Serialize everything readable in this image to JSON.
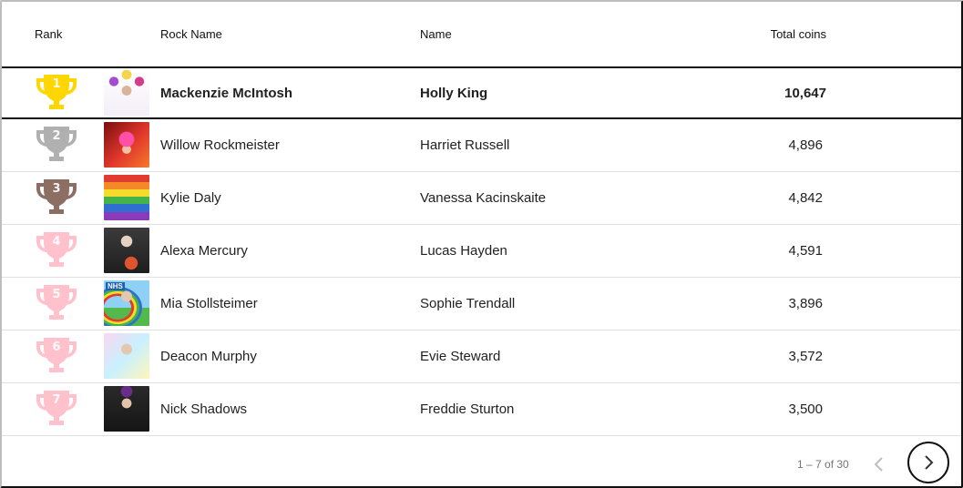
{
  "table": {
    "headers": {
      "rank": "Rank",
      "rock_name": "Rock Name",
      "name": "Name",
      "total_coins": "Total coins"
    },
    "rows": [
      {
        "rank": "1",
        "trophy_color": "#FFD600",
        "rock_name": "Mackenzie McIntosh",
        "name": "Holly King",
        "coins": "10,647"
      },
      {
        "rank": "2",
        "trophy_color": "#B0B0B0",
        "rock_name": "Willow Rockmeister",
        "name": "Harriet Russell",
        "coins": "4,896"
      },
      {
        "rank": "3",
        "trophy_color": "#8D6E63",
        "rock_name": "Kylie Daly",
        "name": "Vanessa Kacinskaite",
        "coins": "4,842"
      },
      {
        "rank": "4",
        "trophy_color": "#FFC1CC",
        "rock_name": "Alexa Mercury",
        "name": "Lucas Hayden",
        "coins": "4,591"
      },
      {
        "rank": "5",
        "trophy_color": "#FFC1CC",
        "rock_name": "Mia Stollsteimer",
        "name": "Sophie Trendall",
        "coins": "3,896"
      },
      {
        "rank": "6",
        "trophy_color": "#FFC1CC",
        "rock_name": "Deacon Murphy",
        "name": "Evie Steward",
        "coins": "3,572"
      },
      {
        "rank": "7",
        "trophy_color": "#FFC1CC",
        "rock_name": "Nick Shadows",
        "name": "Freddie Sturton",
        "coins": "3,500"
      }
    ]
  },
  "pagination": {
    "range_label": "1 – 7 of 30",
    "prev_icon": "chevron-left-icon",
    "next_icon": "chevron-right-icon"
  },
  "avatar_badges": {
    "row5": "NHS"
  }
}
